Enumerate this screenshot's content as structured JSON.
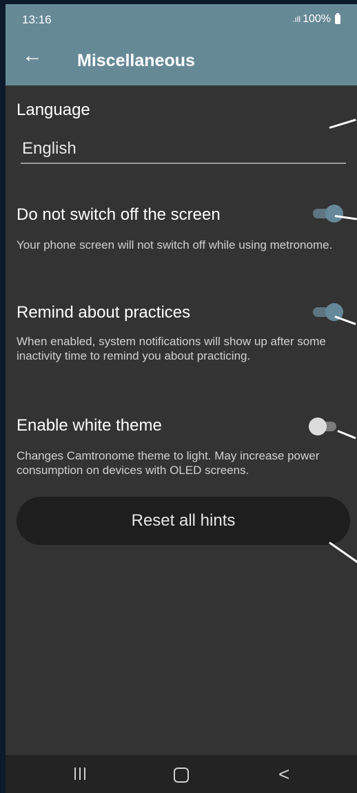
{
  "status_bar": {
    "time": "13:16",
    "signal": ".ıll",
    "battery": "100%"
  },
  "app_bar": {
    "back_icon": "back-arrow-icon",
    "title": "Miscellaneous"
  },
  "language": {
    "label": "Language",
    "value": "English"
  },
  "keep_screen_on": {
    "label": "Do not switch off the screen",
    "description": "Your phone screen will not switch off while using metronome.",
    "enabled": true
  },
  "remind_practices": {
    "label": "Remind about practices",
    "description": "When enabled, system notifications will show up after some inactivity time to remind you about practicing.",
    "enabled": true
  },
  "white_theme": {
    "label": "Enable white theme",
    "description": "Changes Camtronome theme to light. May increase power consumption on devices with OLED screens.",
    "enabled": false
  },
  "reset_hints": {
    "label": "Reset all hints"
  },
  "nav_bar": {
    "recents_icon": "recents-icon",
    "home_icon": "home-icon",
    "back_icon": "back-icon"
  },
  "colors": {
    "app_bar": "#668996",
    "background": "#333333",
    "accent": "#66899a"
  }
}
